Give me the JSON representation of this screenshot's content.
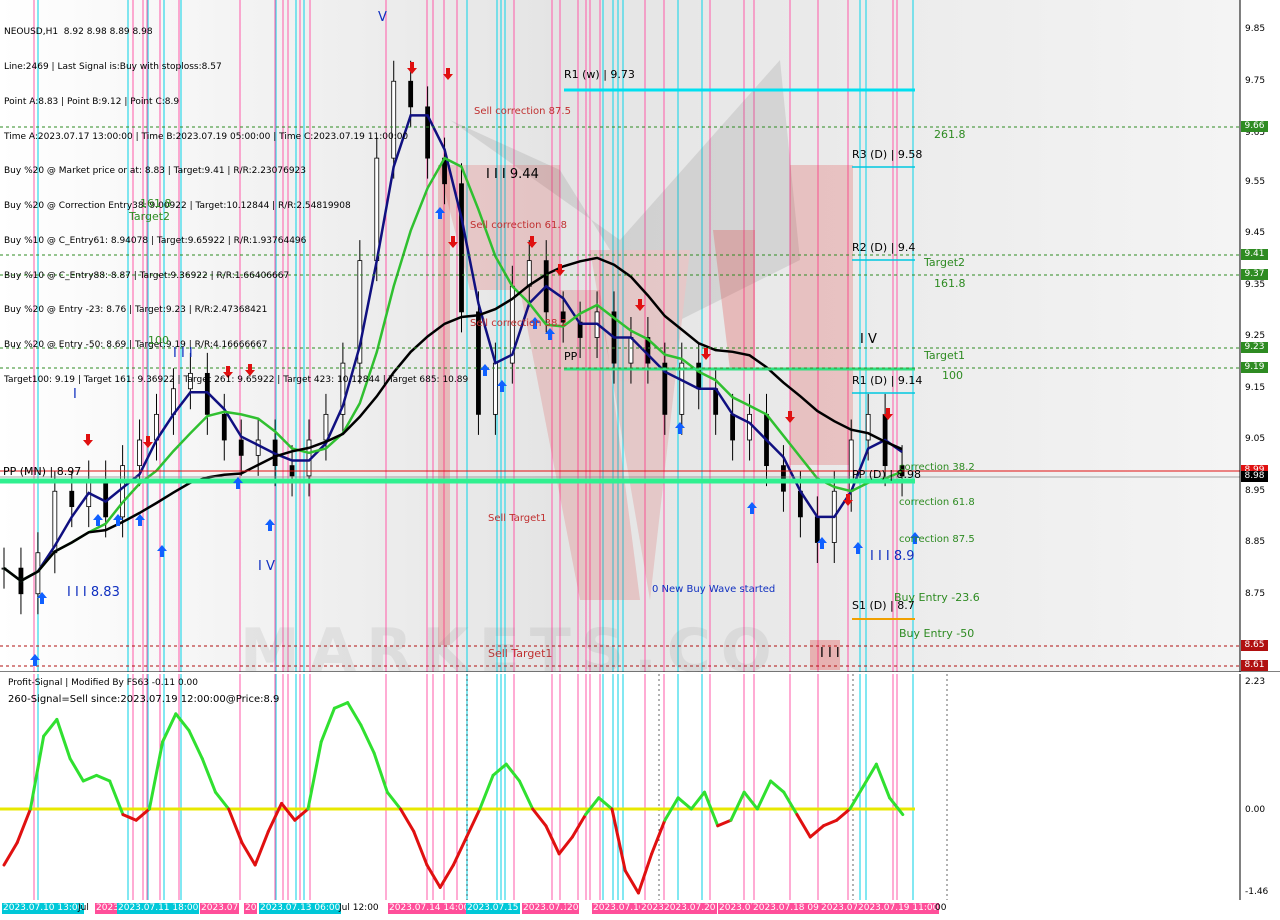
{
  "symbol_header": "NEOUSD,H1  8.92 8.98 8.89 8.98",
  "info_lines": [
    "Line:2469 | Last Signal is:Buy with stoploss:8.57",
    "Point A:8.83 | Point B:9.12 | Point C:8.9",
    "Time A:2023.07.17 13:00:00 | Time B:2023.07.19 05:00:00 | Time C:2023.07.19 11:00:00",
    "Buy %20 @ Market price or at: 8.83 | Target:9.41 | R/R:2.23076923",
    "Buy %20 @ Correction Entry38: 9.00922 | Target:10.12844 | R/R:2.54819908",
    "Buy %10 @ C_Entry61: 8.94078 | Target:9.65922 | R/R:1.93764496",
    "Buy %10 @ C_Entry88: 8.87 | Target:9.36922 | R/R:1.66406667",
    "Buy %20 @ Entry -23: 8.76 | Target:9.23 | R/R:2.47368421",
    "Buy %20 @ Entry -50: 8.69 | Target:9.19 | R/R:4.16666667",
    "Target100: 9.19 | Target 161: 9.36922 | Target 261: 9.65922 | Target 423: 10.12844 | Target 685: 10.89"
  ],
  "price_axis": [
    "9.85",
    "9.75",
    "9.65",
    "9.55",
    "9.45",
    "9.35",
    "9.25",
    "9.15",
    "9.05",
    "8.95",
    "8.85",
    "8.75",
    "8.65"
  ],
  "price_tags": [
    {
      "label": "9.66",
      "color": "#2e8b22",
      "price": 9.66
    },
    {
      "label": "9.41",
      "color": "#2e8b22",
      "price": 9.41
    },
    {
      "label": "9.37",
      "color": "#2e8b22",
      "price": 9.37
    },
    {
      "label": "9.23",
      "color": "#2e8b22",
      "price": 9.23
    },
    {
      "label": "9.19",
      "color": "#2e8b22",
      "price": 9.19
    },
    {
      "label": "8.99",
      "color": "#e01010",
      "price": 8.99
    },
    {
      "label": "8.98",
      "color": "#000000",
      "price": 8.98
    },
    {
      "label": "8.65",
      "color": "#b01010",
      "price": 8.65
    },
    {
      "label": "8.61",
      "color": "#b01010",
      "price": 8.61
    }
  ],
  "chart_labels": {
    "r1w": "R1 (w) | 9.73",
    "r3d": "R3 (D) | 9.58",
    "r2d": "R2 (D) | 9.4",
    "r1d": "R1 (D) | 9.14",
    "ppd": "PP (D) | 8.98",
    "s1d": "S1 (D) | 8.7",
    "ppmn": "PP (MN) | 8.97",
    "pp": "PP",
    "sell_corr_875": "Sell correction 87.5",
    "sell_corr_618": "Sell correction 61.8",
    "sell_corr_382": "Sell correction 38.2",
    "wave_944": "I I I 9.44",
    "wave_883": "I I I 8.83",
    "wave_89": "I I I 8.9",
    "wave_iv_1": "I V",
    "wave_iv_2": "I V",
    "wave_iii_1": "I I I",
    "wave_iii_2": "I I I",
    "wave_i": "I",
    "wave_v": "V",
    "fib_2618": "261.8",
    "fib_1618_left": "161.8",
    "target2_left": "Target2",
    "fib_100_left": "100",
    "target2_right": "Target2",
    "fib_1618_right": "161.8",
    "target1_right": "Target1",
    "fib_100_right": "100",
    "corr_382": "correction 38.2",
    "corr_618": "correction 61.8",
    "corr_875": "correction 87.5",
    "buy_entry_236": "Buy Entry -23.6",
    "buy_entry_50": "Buy Entry -50",
    "new_buy_wave": "0 New Buy Wave started",
    "sell_target1": "Sell Target1",
    "watermark": "MARKETS.CO"
  },
  "oscillator": {
    "title": "Profit-Signal | Modified By FS63 -0.11 0.00",
    "signal_text": "260-Signal=Sell since:2023.07.19 12:00:00@Price:8.9",
    "axis": [
      "2.23",
      "0.00",
      "-1.46"
    ]
  },
  "time_axis": [
    {
      "label": "2023.07.10 13:00",
      "highlight": true
    },
    {
      "label": "Jul",
      "highlight": false
    },
    {
      "label": "2023",
      "highlight": true
    },
    {
      "label": "2023.07.11 18:00",
      "highlight": true
    },
    {
      "label": "2023.07",
      "highlight": true
    },
    {
      "label": "20",
      "highlight": true
    },
    {
      "label": "2023.07.13 06:00",
      "highlight": true
    },
    {
      "label": "Jul 12:00",
      "highlight": false
    },
    {
      "label": "2023.07.14 14:00",
      "highlight": true
    },
    {
      "label": "2023.07.15",
      "highlight": true
    },
    {
      "label": "2023.07.1",
      "highlight": true
    },
    {
      "label": "20",
      "highlight": true
    },
    {
      "label": "2023.07.16",
      "highlight": true
    },
    {
      "label": "2023",
      "highlight": true
    },
    {
      "label": "2023.07.20",
      "highlight": true
    },
    {
      "label": "2023.07",
      "highlight": true
    },
    {
      "label": "2023.07.18 09:",
      "highlight": true
    },
    {
      "label": "2023.07",
      "highlight": true
    },
    {
      "label": "2023.07.19 11:00",
      "highlight": true
    },
    {
      "label": "00",
      "highlight": false
    }
  ],
  "chart_data": {
    "type": "line",
    "title": "NEOUSD,H1",
    "ylim": [
      8.59,
      9.95
    ],
    "close_series_approx": [
      8.8,
      8.75,
      8.83,
      8.95,
      8.92,
      8.97,
      8.9,
      9.0,
      9.05,
      9.1,
      9.15,
      9.18,
      9.1,
      9.05,
      9.02,
      9.05,
      9.0,
      8.98,
      9.05,
      9.1,
      9.2,
      9.4,
      9.6,
      9.75,
      9.7,
      9.6,
      9.55,
      9.3,
      9.1,
      9.2,
      9.35,
      9.4,
      9.3,
      9.28,
      9.25,
      9.3,
      9.2,
      9.25,
      9.2,
      9.1,
      9.2,
      9.15,
      9.1,
      9.05,
      9.1,
      9.0,
      8.95,
      8.9,
      8.85,
      8.95,
      9.05,
      9.1,
      9.0,
      8.98
    ],
    "levels": {
      "R1_w": 9.73,
      "R3_D": 9.58,
      "R2_D": 9.4,
      "R1_D": 9.14,
      "PP_D": 8.98,
      "S1_D": 8.7,
      "PP_MN": 8.97
    }
  }
}
